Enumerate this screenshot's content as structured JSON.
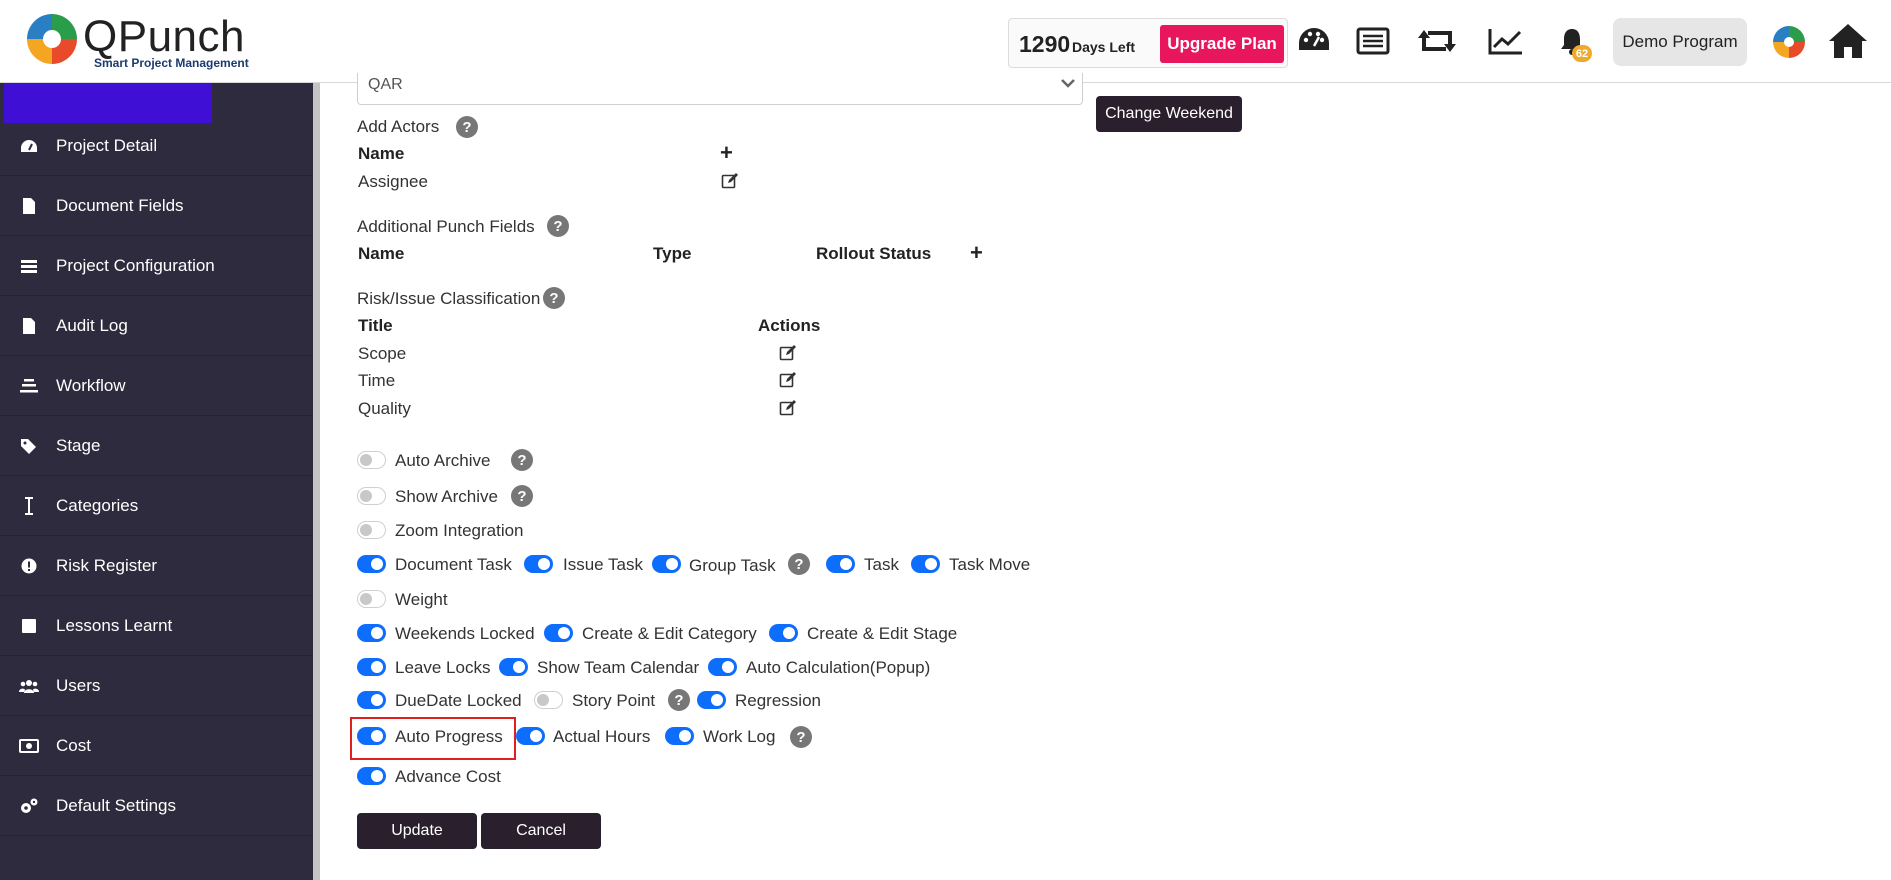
{
  "header": {
    "logo_text": "QPunch",
    "logo_tagline": "Smart Project Management",
    "days_left_number": "1290",
    "days_left_label": "Days Left",
    "upgrade_label": "Upgrade Plan",
    "notification_count": "62",
    "program_label": "Demo Program"
  },
  "sidebar": {
    "items": [
      {
        "label": "Project Detail",
        "icon": "dashboard-icon"
      },
      {
        "label": "Document Fields",
        "icon": "file-icon"
      },
      {
        "label": "Project Configuration",
        "icon": "config-icon"
      },
      {
        "label": "Audit Log",
        "icon": "file-icon"
      },
      {
        "label": "Workflow",
        "icon": "workflow-icon"
      },
      {
        "label": "Stage",
        "icon": "tags-icon"
      },
      {
        "label": "Categories",
        "icon": "text-cursor-icon"
      },
      {
        "label": "Risk Register",
        "icon": "alert-icon"
      },
      {
        "label": "Lessons Learnt",
        "icon": "square-icon"
      },
      {
        "label": "Users",
        "icon": "users-icon"
      },
      {
        "label": "Cost",
        "icon": "money-icon"
      },
      {
        "label": "Default Settings",
        "icon": "cogs-icon"
      }
    ]
  },
  "form": {
    "currency_value": "QAR",
    "change_weekend_label": "Change Weekend",
    "actors": {
      "title": "Add Actors",
      "col_name": "Name",
      "rows": [
        "Assignee"
      ]
    },
    "punch_fields": {
      "title": "Additional Punch Fields",
      "col_name": "Name",
      "col_type": "Type",
      "col_rollout": "Rollout Status"
    },
    "risk": {
      "title": "Risk/Issue Classification",
      "col_title": "Title",
      "col_actions": "Actions",
      "rows": [
        "Scope",
        "Time",
        "Quality"
      ]
    },
    "toggles": {
      "auto_archive": {
        "label": "Auto Archive",
        "on": false
      },
      "show_archive": {
        "label": "Show Archive",
        "on": false
      },
      "zoom_integration": {
        "label": "Zoom Integration",
        "on": false
      },
      "document_task": {
        "label": "Document Task",
        "on": true
      },
      "issue_task": {
        "label": "Issue Task",
        "on": true
      },
      "group_task": {
        "label": "Group Task",
        "on": true
      },
      "task": {
        "label": "Task",
        "on": true
      },
      "task_move": {
        "label": "Task Move",
        "on": true
      },
      "weight": {
        "label": "Weight",
        "on": false
      },
      "weekends_locked": {
        "label": "Weekends Locked",
        "on": true
      },
      "create_edit_category": {
        "label": "Create & Edit Category",
        "on": true
      },
      "create_edit_stage": {
        "label": "Create & Edit Stage",
        "on": true
      },
      "leave_locks": {
        "label": "Leave Locks",
        "on": true
      },
      "show_team_calendar": {
        "label": "Show Team Calendar",
        "on": true
      },
      "auto_calculation": {
        "label": "Auto Calculation(Popup)",
        "on": true
      },
      "duedate_locked": {
        "label": "DueDate Locked",
        "on": true
      },
      "story_point": {
        "label": "Story Point",
        "on": false
      },
      "regression": {
        "label": "Regression",
        "on": true
      },
      "auto_progress": {
        "label": "Auto Progress",
        "on": true
      },
      "actual_hours": {
        "label": "Actual Hours",
        "on": true
      },
      "work_log": {
        "label": "Work Log",
        "on": true
      },
      "advance_cost": {
        "label": "Advance Cost",
        "on": true
      }
    },
    "update_label": "Update",
    "cancel_label": "Cancel"
  },
  "colors": {
    "sidebar_bg": "#2d2b3d",
    "sidebar_accent": "#3f0fd6",
    "toggle_on": "#0d6efd",
    "upgrade": "#e8175d",
    "dark_button": "#2a1f2d",
    "highlight": "#e02020"
  }
}
